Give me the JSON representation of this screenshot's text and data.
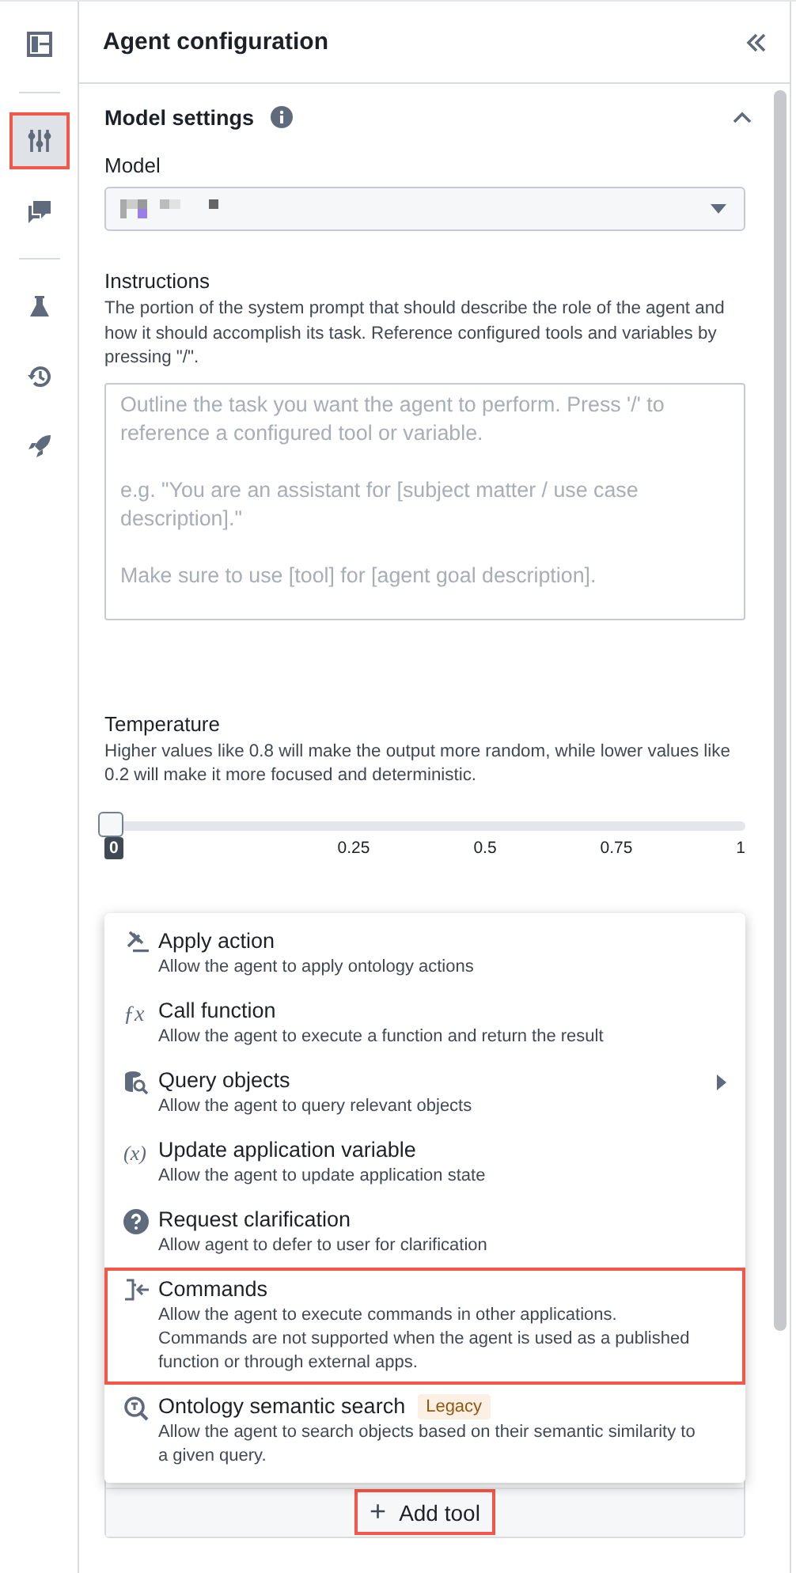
{
  "sidebar": {
    "items": [
      {
        "selected": false,
        "highlighted": false
      },
      {
        "selected": true,
        "highlighted": true
      },
      {
        "selected": false,
        "highlighted": false
      },
      {
        "selected": false,
        "highlighted": false
      },
      {
        "selected": false,
        "highlighted": false
      },
      {
        "selected": false,
        "highlighted": false
      }
    ]
  },
  "panel": {
    "title": "Agent configuration"
  },
  "model_settings": {
    "title": "Model settings",
    "expanded": true,
    "model": {
      "label": "Model"
    },
    "instructions": {
      "label": "Instructions",
      "description": "The portion of the system prompt that should describe the role of the agent and how it should accomplish its task. Reference configured tools and variables by pressing \"/\".",
      "placeholder": "Outline the task you want the agent to perform. Press '/' to reference a configured tool or variable.\n\ne.g. \"You are an assistant for [subject matter / use case description].\"\n\nMake sure to use [tool] for [agent goal description]."
    },
    "temperature": {
      "label": "Temperature",
      "description": "Higher values like 0.8 will make the output more random, while lower values like 0.2 will make it more focused and deterministic.",
      "level": 0,
      "value": "0",
      "ticks": [
        "0.25",
        "0.5",
        "0.75",
        "1"
      ]
    }
  },
  "tool_menu": {
    "items": [
      {
        "title": "Apply action",
        "description": "Allow the agent to apply ontology actions",
        "submenu": false,
        "highlighted": false
      },
      {
        "title": "Call function",
        "icon": "ƒx",
        "description": "Allow the agent to execute a function and return the result",
        "submenu": false,
        "highlighted": false
      },
      {
        "title": "Query objects",
        "description": "Allow the agent to query relevant objects",
        "submenu": true,
        "highlighted": false
      },
      {
        "title": "Update application variable",
        "icon": "(x)",
        "description": "Allow the agent to update application state",
        "submenu": false,
        "highlighted": false
      },
      {
        "title": "Request clarification",
        "description": "Allow agent to defer to user for clarification",
        "submenu": false,
        "highlighted": false
      },
      {
        "title": "Commands",
        "description": "Allow the agent to execute commands in other applications. Commands are not supported when the agent is used as a published function or through external apps.",
        "submenu": false,
        "highlighted": true
      },
      {
        "title": "Ontology semantic search",
        "badge": "Legacy",
        "description": "Allow the agent to search objects based on their semantic similarity to a given query.",
        "submenu": false,
        "highlighted": false
      }
    ]
  },
  "add_tool": {
    "label": "Add tool",
    "icon": "+",
    "highlighted": true
  }
}
